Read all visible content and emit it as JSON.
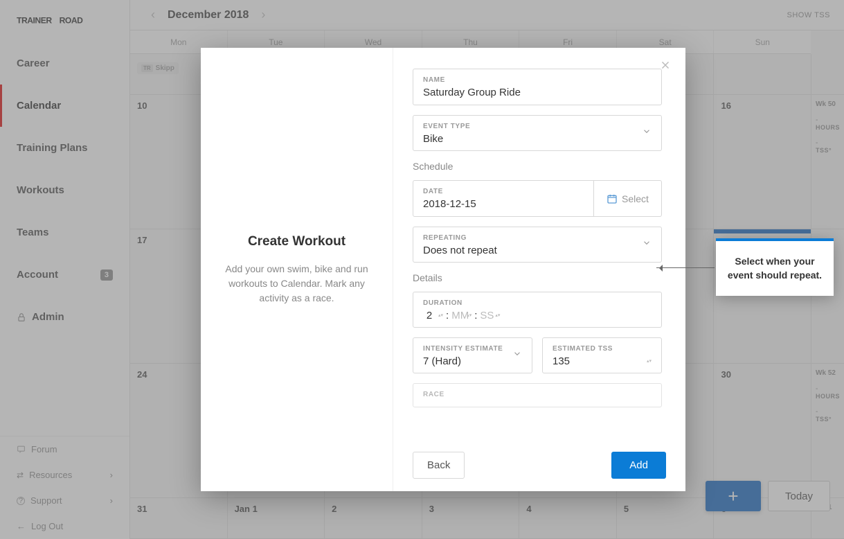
{
  "logo": "TRAINERROAD",
  "sidebar": {
    "items": [
      {
        "label": "Career"
      },
      {
        "label": "Calendar"
      },
      {
        "label": "Training Plans"
      },
      {
        "label": "Workouts"
      },
      {
        "label": "Teams"
      },
      {
        "label": "Account",
        "badge": "3"
      },
      {
        "label": "Admin"
      }
    ],
    "bottom": [
      {
        "label": "Forum"
      },
      {
        "label": "Resources"
      },
      {
        "label": "Support"
      },
      {
        "label": "Log Out"
      }
    ]
  },
  "calendar": {
    "month": "December 2018",
    "show_tss": "SHOW TSS",
    "days": [
      "Mon",
      "Tue",
      "Wed",
      "Thu",
      "Fri",
      "Sat",
      "Sun"
    ],
    "weeks": [
      {
        "cells": [
          "",
          "",
          "",
          "",
          "",
          "",
          ""
        ],
        "wk": "",
        "event": {
          "col": 0,
          "text": "Skipp"
        }
      },
      {
        "cells": [
          "10",
          "",
          "",
          "",
          "",
          "",
          "16"
        ],
        "wk": "Wk 50"
      },
      {
        "cells": [
          "17",
          "",
          "",
          "",
          "",
          "",
          ""
        ],
        "wk": ""
      },
      {
        "cells": [
          "24",
          "",
          "",
          "",
          "",
          "",
          "30"
        ],
        "wk": "Wk 52"
      },
      {
        "cells": [
          "31",
          "Jan  1",
          "2",
          "3",
          "4",
          "5",
          "6"
        ],
        "wk": "Wk 1"
      }
    ],
    "stat_hours": "HOURS",
    "stat_tss": "TSS°",
    "dash": "-",
    "today_btn": "Today"
  },
  "modal": {
    "title": "Create Workout",
    "subtitle": "Add your own swim, bike and run workouts to Calendar. Mark any activity as a race.",
    "name_label": "NAME",
    "name_value": "Saturday Group Ride",
    "event_type_label": "EVENT TYPE",
    "event_type_value": "Bike",
    "schedule_label": "Schedule",
    "date_label": "DATE",
    "date_value": "2018-12-15",
    "select_label": "Select",
    "repeating_label": "REPEATING",
    "repeating_value": "Does not repeat",
    "details_label": "Details",
    "duration_label": "DURATION",
    "duration_h": "2",
    "duration_m": "MM",
    "duration_s": "SS",
    "colon": ":",
    "intensity_label": "INTENSITY ESTIMATE",
    "intensity_value": "7 (Hard)",
    "tss_label": "ESTIMATED TSS",
    "tss_value": "135",
    "race_label": "RACE",
    "back_btn": "Back",
    "add_btn": "Add"
  },
  "tooltip": "Select when your event should repeat."
}
